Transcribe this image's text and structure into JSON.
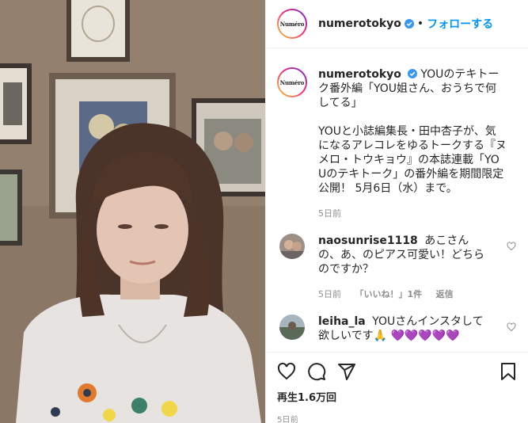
{
  "post": {
    "username": "numerotokyo",
    "avatar_logo": "Numéro",
    "dot": "•",
    "follow_label": "フォローする"
  },
  "caption": {
    "username": "numerotokyo",
    "text": "YOUのテキトーク番外編「YOU姐さん、おうちで何してる」\n\nYOUと小誌編集長・田中杏子が、気になるアレコレをゆるトークする『ヌメロ・トウキョウ』の本誌連載「YOUのテキトーク」の番外編を期間限定公開！ 5月6日（水）まで。",
    "time": "5日前"
  },
  "comments": [
    {
      "username": "naosunrise1118",
      "text": "あこさんの、あ、のピアス可愛い！どちらのですか？",
      "time": "5日前",
      "likes": "「いいね！」1件",
      "reply": "返信"
    },
    {
      "username": "leiha_la",
      "text": "YOUさんインスタして欲しいです🙏",
      "hearts": "💜💜💜💜💜"
    }
  ],
  "actions": {
    "icons": [
      "heart-icon",
      "comment-icon",
      "share-icon",
      "bookmark-icon"
    ],
    "views": "再生1.6万回",
    "date": "5日前"
  },
  "colors": {
    "accent": "#0095f6",
    "text": "#262626",
    "muted": "#8e8e8e",
    "border": "#efefef"
  }
}
